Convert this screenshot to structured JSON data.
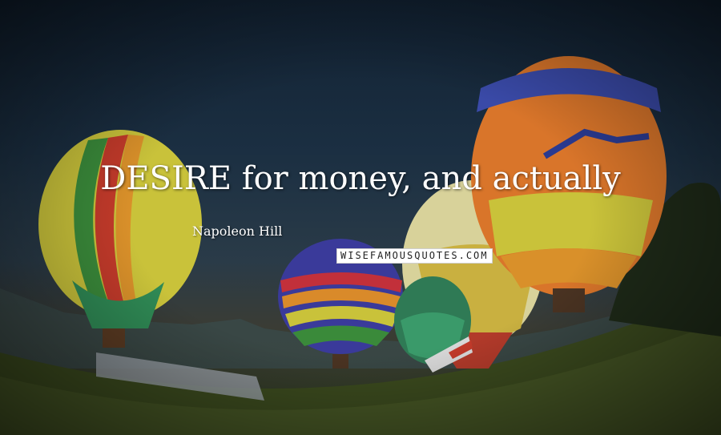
{
  "quote": {
    "text": "DESIRE for money, and actually"
  },
  "author": {
    "name": "Napoleon Hill"
  },
  "watermark": {
    "text": "WISEFAMOUSQUOTES.COM"
  },
  "colors": {
    "sky_top": "#122233",
    "grass": "#3b4a1e",
    "text": "#ffffff",
    "watermark_bg": "#ffffff"
  }
}
